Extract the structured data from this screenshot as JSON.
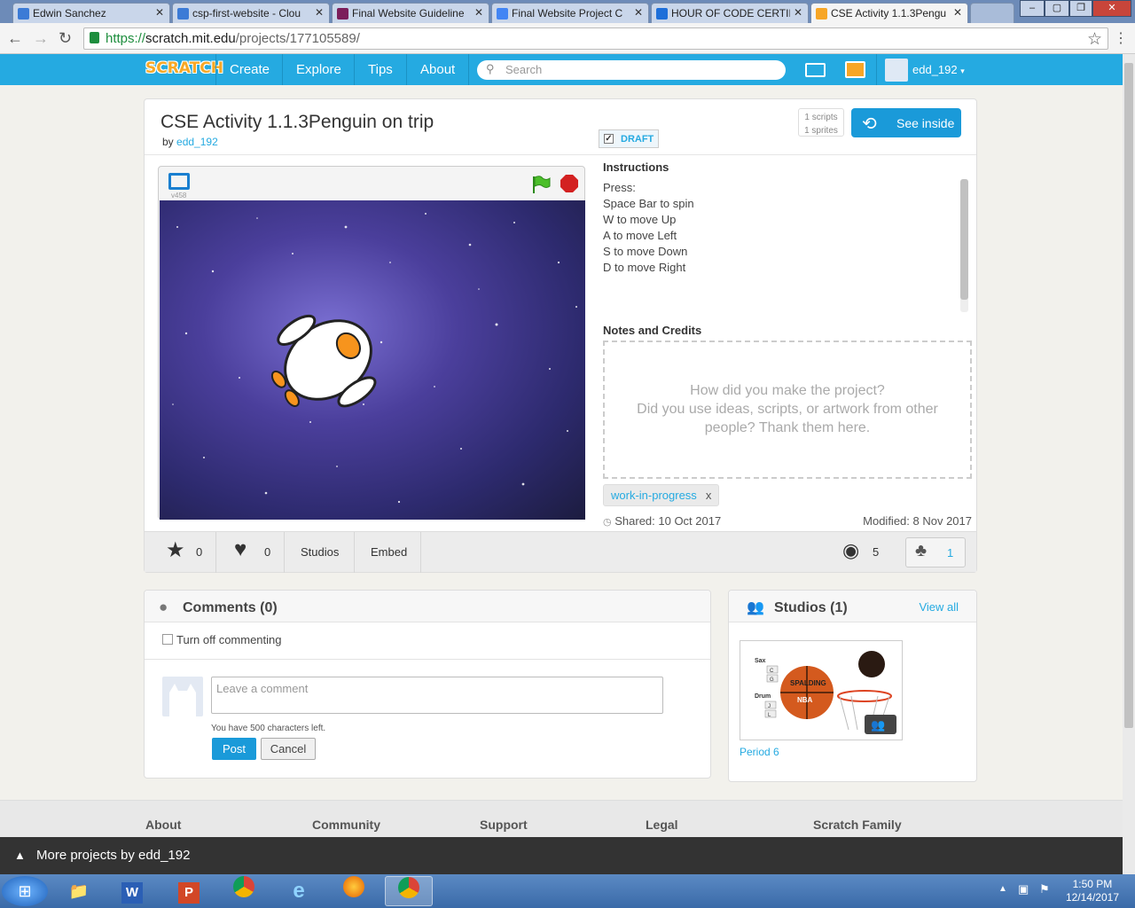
{
  "browser": {
    "tabs": [
      {
        "title": "Edwin Sanchez",
        "color": "#3c7bd6"
      },
      {
        "title": "csp-first-website - Clou",
        "color": "#3c7bd6"
      },
      {
        "title": "Final Website Guideline",
        "color": "#7b1e5b"
      },
      {
        "title": "Final Website Project C",
        "color": "#4285f4"
      },
      {
        "title": "HOUR OF CODE CERTIF",
        "color": "#1e6fd9"
      },
      {
        "title": "CSE Activity 1.1.3Pengu",
        "color": "#f7a626"
      }
    ],
    "url": "https://scratch.mit.edu/projects/177105589/",
    "url_scheme": "https://",
    "url_host": "scratch.mit.edu",
    "url_path": "/projects/177105589/"
  },
  "nav": {
    "logo": "SCRATCH",
    "items": [
      "Create",
      "Explore",
      "Tips",
      "About"
    ],
    "search_placeholder": "Search",
    "username": "edd_192"
  },
  "project": {
    "title": "CSE Activity 1.1.3Penguin on trip",
    "by_label": "by",
    "author": "edd_192",
    "scripts_count": "1 scripts",
    "sprites_count": "1 sprites",
    "see_inside": "See inside",
    "draft_label": "DRAFT",
    "version": "v458",
    "instructions_heading": "Instructions",
    "instructions": [
      "Press:",
      "Space Bar to spin",
      "W to move Up",
      "A to move Left",
      "S to move Down",
      "D to move Right"
    ],
    "notes_heading": "Notes and Credits",
    "notes_placeholder_1": "How did you make the project?",
    "notes_placeholder_2": "Did you use ideas, scripts, or artwork from other",
    "notes_placeholder_3": "people? Thank them here.",
    "tag": "work-in-progress",
    "tag_remove": "x",
    "shared": "Shared: 10 Oct 2017",
    "modified": "Modified: 8 Nov 2017"
  },
  "stats": {
    "favorites": "0",
    "loves": "0",
    "studios_label": "Studios",
    "embed_label": "Embed",
    "views": "5",
    "remixes": "1"
  },
  "comments": {
    "heading": "Comments (0)",
    "turn_off": "Turn off commenting",
    "placeholder": "Leave a comment",
    "chars_left": "You have 500 characters left.",
    "post": "Post",
    "cancel": "Cancel"
  },
  "studios": {
    "heading": "Studios (1)",
    "view_all": "View all",
    "studio_name": "Period 6",
    "thumb_labels": [
      "Sax",
      "C",
      "G",
      "Drum",
      "J",
      "L",
      "SPALDING",
      "NBA"
    ]
  },
  "footer": {
    "columns": [
      "About",
      "Community",
      "Support",
      "Legal",
      "Scratch Family"
    ],
    "more_projects": "More projects by edd_192"
  },
  "taskbar": {
    "time": "1:50 PM",
    "date": "12/14/2017"
  },
  "colors": {
    "scratch_blue": "#25aae1",
    "button_blue": "#1a9ad9"
  }
}
